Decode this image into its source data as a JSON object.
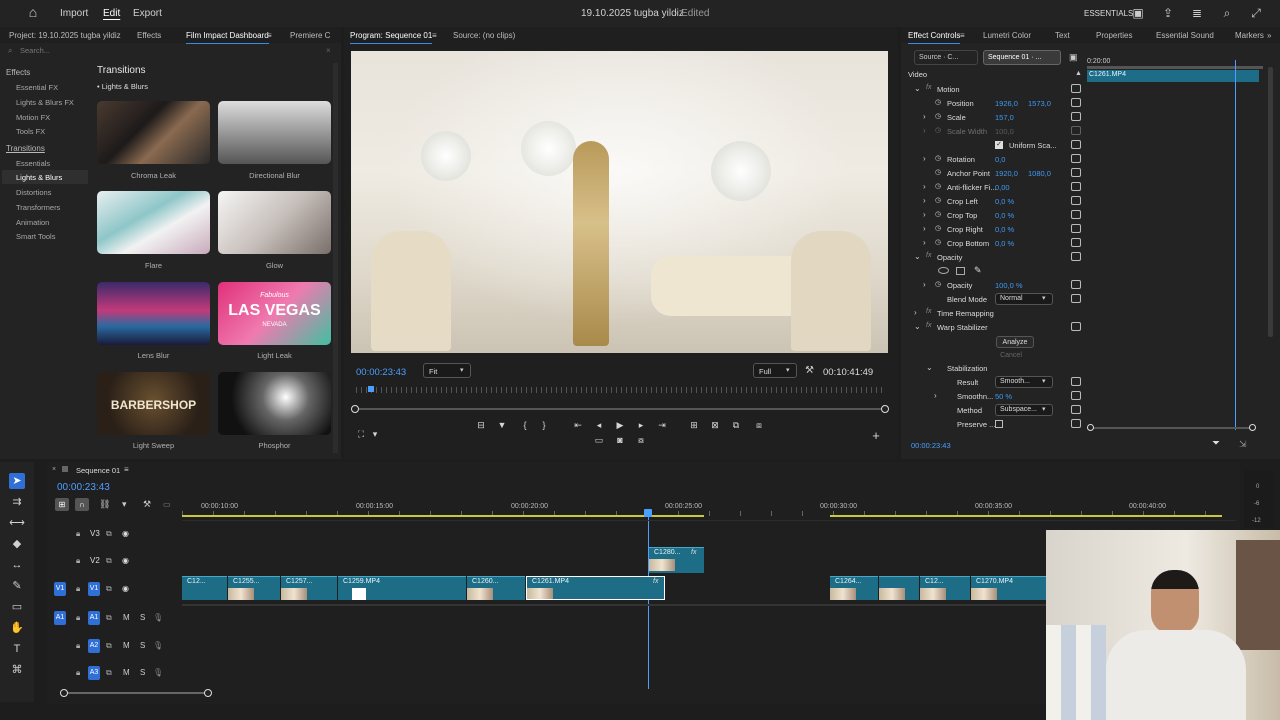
{
  "topbar": {
    "menu": [
      "Import",
      "Edit",
      "Export"
    ],
    "title": "19.10.2025 tugba yildiz",
    "status": "- Edited",
    "workspace": "ESSENTIALS"
  },
  "leftpanel": {
    "project": "Project: 19.10.2025 tugba yildiz",
    "tabs": [
      "Effects",
      "Film Impact Dashboard",
      "Premiere C"
    ],
    "search_placeholder": "Search...",
    "effects_head": "Effects",
    "effects_items": [
      "Essential FX",
      "Lights & Blurs FX",
      "Motion FX",
      "Tools FX"
    ],
    "transitions_head": "Transitions",
    "transitions_items": [
      "Essentials",
      "Lights & Blurs",
      "Distortions",
      "Transformers",
      "Animation",
      "Smart Tools"
    ],
    "content_title": "Transitions",
    "content_sub": "• Lights & Blurs",
    "thumbs": [
      "Chroma Leak",
      "Directional Blur",
      "Flare",
      "Glow",
      "Lens Blur",
      "Light Leak",
      "Light Sweep",
      "Phosphor"
    ],
    "lasvegas": [
      "Fabulous",
      "LAS VEGAS",
      "NEVADA"
    ],
    "barbershop": "BARBERSHOP"
  },
  "program": {
    "tabs": [
      "Program: Sequence 01",
      "Source: (no clips)"
    ],
    "timecode": "00:00:23:43",
    "fit": "Fit",
    "quality": "Full",
    "duration": "00:10:41:49"
  },
  "effectcontrols": {
    "tabs": [
      "Effect Controls",
      "Lumetri Color",
      "Text",
      "Properties",
      "Essential Sound",
      "Markers"
    ],
    "source": "Source · C...",
    "sequence": "Sequence 01 · ...",
    "video": "Video",
    "mini_time": "0:20:00",
    "clip": "C1261.MP4",
    "motion": "Motion",
    "position": "Position",
    "pos_x": "1926,0",
    "pos_y": "1573,0",
    "scale": "Scale",
    "scale_val": "157,0",
    "scale_width": "Scale Width",
    "scale_width_val": "100,0",
    "uniform": "Uniform Sca...",
    "rotation": "Rotation",
    "rotation_val": "0,0",
    "anchor": "Anchor Point",
    "anchor_x": "1920,0",
    "anchor_y": "1080,0",
    "antiflicker": "Anti-flicker Fi...",
    "antiflicker_val": "0,00",
    "crop_left": "Crop Left",
    "crop_top": "Crop Top",
    "crop_right": "Crop Right",
    "crop_bottom": "Crop Bottom",
    "crop_val": "0,0 %",
    "opacity": "Opacity",
    "opacity_label": "Opacity",
    "opacity_val": "100,0 %",
    "blend": "Blend Mode",
    "blend_val": "Normal",
    "time_remap": "Time Remapping",
    "warp": "Warp Stabilizer",
    "analyze": "Analyze",
    "cancel": "Cancel",
    "stabilization": "Stabilization",
    "result": "Result",
    "result_val": "Smooth...",
    "smooth": "Smoothn...",
    "smooth_val": "50 %",
    "method": "Method",
    "method_val": "Subspace...",
    "preserve": "Preserve ...",
    "bottom_time": "00:00:23:43"
  },
  "timeline": {
    "tab": "Sequence 01",
    "timecode": "00:00:23:43",
    "ruler": [
      "00:00:10:00",
      "00:00:15:00",
      "00:00:20:00",
      "00:00:25:00",
      "00:00:30:00",
      "00:00:35:00",
      "00:00:40:00"
    ],
    "tracks": [
      "V3",
      "V2",
      "V1",
      "A1",
      "A2",
      "A3"
    ],
    "track_ms": [
      "M",
      "S"
    ],
    "clips": [
      "C12...",
      "C1255...",
      "C1257...",
      "C1259.MP4",
      "C1260...",
      "C1261.MP4",
      "C1264...",
      "C12...",
      "C1270.MP4"
    ],
    "v2_clip": "C1280...",
    "fx": "fx"
  }
}
